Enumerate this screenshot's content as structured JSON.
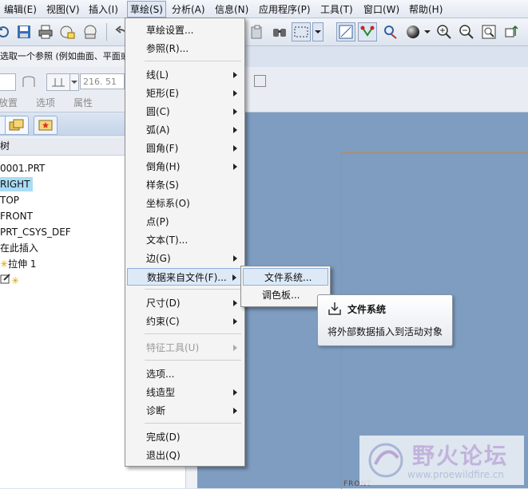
{
  "menubar": [
    "编辑(E)",
    "视图(V)",
    "插入(I)",
    "草绘(S)",
    "分析(A)",
    "信息(N)",
    "应用程序(P)",
    "工具(T)",
    "窗口(W)",
    "帮助(H)"
  ],
  "prompt": "选取一个参照 (例如曲面、平面或",
  "dashboard": {
    "value": "216. 51",
    "tabs": [
      "放置",
      "选项",
      "属性"
    ]
  },
  "tree": {
    "header": "树",
    "nodes": [
      "0001.PRT",
      "RIGHT",
      "TOP",
      "FRONT",
      "PRT_CSYS_DEF",
      "在此插入",
      "拉伸 1"
    ]
  },
  "sketch_menu": {
    "items": [
      {
        "label": "草绘设置...",
        "submenu": false
      },
      {
        "label": "参照(R)...",
        "submenu": false
      },
      {
        "label": "线(L)",
        "submenu": true
      },
      {
        "label": "矩形(E)",
        "submenu": true
      },
      {
        "label": "圆(C)",
        "submenu": true
      },
      {
        "label": "弧(A)",
        "submenu": true
      },
      {
        "label": "圆角(F)",
        "submenu": true
      },
      {
        "label": "倒角(H)",
        "submenu": true
      },
      {
        "label": "样条(S)",
        "submenu": false
      },
      {
        "label": "坐标系(O)",
        "submenu": false
      },
      {
        "label": "点(P)",
        "submenu": false
      },
      {
        "label": "文本(T)...",
        "submenu": false
      },
      {
        "label": "边(G)",
        "submenu": true
      },
      {
        "label": "数据来自文件(F)...",
        "submenu": true
      },
      {
        "label": "尺寸(D)",
        "submenu": true
      },
      {
        "label": "约束(C)",
        "submenu": true
      },
      {
        "label": "特征工具(U)",
        "submenu": true
      },
      {
        "label": "选项...",
        "submenu": false
      },
      {
        "label": "线造型",
        "submenu": true
      },
      {
        "label": "诊断",
        "submenu": true
      },
      {
        "label": "完成(D)",
        "submenu": false
      },
      {
        "label": "退出(Q)",
        "submenu": false
      }
    ]
  },
  "submenu": [
    "文件系统...",
    "调色板..."
  ],
  "tooltip": {
    "title": "文件系统",
    "description": "将外部数据插入到活动对象"
  },
  "graphics": {
    "label": "FRONT"
  },
  "watermark": {
    "title": "野火论坛",
    "url": "www.proewildfire.cn"
  }
}
